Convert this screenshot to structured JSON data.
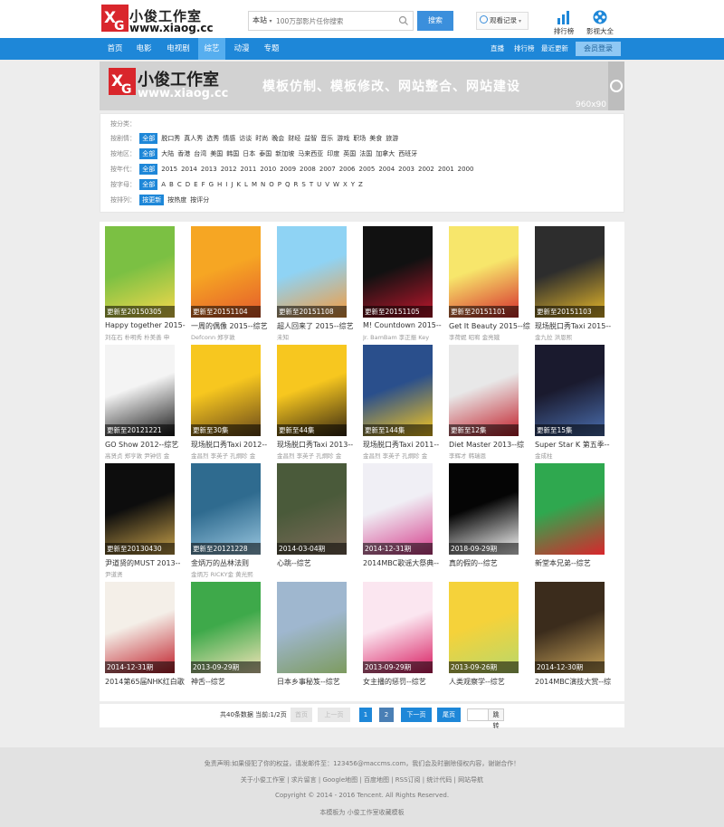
{
  "header": {
    "logo_cn": "小俊工作室",
    "logo_en": "www.xiaog.cc",
    "search_category": "本站",
    "search_placeholder": "100万部影片任你搜索",
    "search_button": "搜索",
    "history_label": "观看记录",
    "rank_label": "排行榜",
    "movies_label": "影视大全"
  },
  "nav": {
    "items": [
      "首页",
      "电影",
      "电视剧",
      "综艺",
      "动漫",
      "专题"
    ],
    "active_index": 3,
    "right_links": [
      "直播",
      "排行榜",
      "最近更新"
    ],
    "member_button": "会员登录"
  },
  "banner": {
    "logo_cn": "小俊工作室",
    "logo_en": "www.xiaog.cc",
    "slogan": "模板仿制、模板修改、网站整合、网站建设",
    "size_text": "960x90"
  },
  "filters": {
    "category_label": "按分类：",
    "genre": {
      "label": "按剧情：",
      "options": [
        "全部",
        "脱口秀",
        "真人秀",
        "选秀",
        "情感",
        "访谈",
        "时尚",
        "晚会",
        "财经",
        "益智",
        "音乐",
        "游戏",
        "职场",
        "美食",
        "旅游"
      ]
    },
    "region": {
      "label": "按地区：",
      "options": [
        "全部",
        "大陆",
        "香港",
        "台湾",
        "美国",
        "韩国",
        "日本",
        "泰国",
        "新加坡",
        "马来西亚",
        "印度",
        "英国",
        "法国",
        "加拿大",
        "西班牙"
      ]
    },
    "year": {
      "label": "按年代：",
      "options": [
        "全部",
        "2015",
        "2014",
        "2013",
        "2012",
        "2011",
        "2010",
        "2009",
        "2008",
        "2007",
        "2006",
        "2005",
        "2004",
        "2003",
        "2002",
        "2001",
        "2000"
      ]
    },
    "letter": {
      "label": "按字母：",
      "options": [
        "全部",
        "A",
        "B",
        "C",
        "D",
        "E",
        "F",
        "G",
        "H",
        "I",
        "J",
        "K",
        "L",
        "M",
        "N",
        "O",
        "P",
        "Q",
        "R",
        "S",
        "T",
        "U",
        "V",
        "W",
        "X",
        "Y",
        "Z"
      ]
    },
    "sort": {
      "label": "按排列：",
      "options": [
        "按更新",
        "按热度",
        "按评分"
      ]
    }
  },
  "cards": [
    {
      "title": "Happy together 2015-",
      "sub": "刘在石 朴明秀 朴美善 申",
      "badge": "更新至20150305",
      "colors": [
        "#7bc043",
        "#f7d94c"
      ]
    },
    {
      "title": "一周的偶像 2015--综艺",
      "sub": "Defconn 郑亨敦",
      "badge": "更新至20151104",
      "colors": [
        "#f6a623",
        "#e45a2c"
      ]
    },
    {
      "title": "超人回来了 2015--综艺",
      "sub": "未知",
      "badge": "更新至20151108",
      "colors": [
        "#8fd3f4",
        "#f59b3d"
      ]
    },
    {
      "title": "M! Countdown 2015--",
      "sub": "Jr. BamBam 李正振 Key",
      "badge": "更新至20151105",
      "colors": [
        "#111111",
        "#c0172d"
      ]
    },
    {
      "title": "Get It Beauty 2015--综",
      "sub": "李荷妮 昭宥 金亮娥",
      "badge": "更新至20151101",
      "colors": [
        "#f7e66b",
        "#d62c2c"
      ]
    },
    {
      "title": "现场脱口秀Taxi 2015--",
      "sub": "金九拉 洪恩熙",
      "badge": "更新至20151103",
      "colors": [
        "#2d2d2d",
        "#e8b92a"
      ]
    },
    {
      "title": "GO Show 2012--综艺",
      "sub": "高贤贞 郑亨敦 尹钟信 金",
      "badge": "更新至20121221",
      "colors": [
        "#f4f4f4",
        "#1a1a1a"
      ]
    },
    {
      "title": "现场脱口秀Taxi 2012--",
      "sub": "金昌烈 李英子 孔炯眕 金",
      "badge": "更新至30集",
      "colors": [
        "#f7c71f",
        "#6b4a1a"
      ]
    },
    {
      "title": "现场脱口秀Taxi 2013--",
      "sub": "金昌烈 李英子 孔炯眕 金",
      "badge": "更新至44集",
      "colors": [
        "#f7c71f",
        "#3a2a12"
      ]
    },
    {
      "title": "现场脱口秀Taxi 2011--",
      "sub": "金昌烈 李英子 孔炯眕 金",
      "badge": "更新至144集",
      "colors": [
        "#2a4f8c",
        "#f7c71f"
      ]
    },
    {
      "title": "Diet Master 2013--综",
      "sub": "李辉才 韩瑞恩",
      "badge": "更新至12集",
      "colors": [
        "#e8e8e8",
        "#c21f2a"
      ]
    },
    {
      "title": "Super Star K 第五季--",
      "sub": "金成柱",
      "badge": "更新至15集",
      "colors": [
        "#1a1a2e",
        "#4b6fb0"
      ]
    },
    {
      "title": "尹道贤的MUST 2013--",
      "sub": "尹道贤",
      "badge": "更新至20130430",
      "colors": [
        "#0d0d0d",
        "#c9a24a"
      ]
    },
    {
      "title": "金炳万的丛林法则",
      "sub": "金炳万 RICKY金 黄光熙",
      "badge": "更新至20121228",
      "colors": [
        "#2f6b8f",
        "#9ac7e0"
      ]
    },
    {
      "title": "心跳--综艺",
      "sub": "",
      "badge": "2014-03-04期",
      "colors": [
        "#4a5a3a",
        "#7d6b5a"
      ]
    },
    {
      "title": "2014MBC歌谣大祭典--",
      "sub": "",
      "badge": "2014-12-31期",
      "colors": [
        "#f0eff5",
        "#d53f8c"
      ]
    },
    {
      "title": "真的假的--综艺",
      "sub": "",
      "badge": "2018-09-29期",
      "colors": [
        "#050505",
        "#ffffff"
      ]
    },
    {
      "title": "新堂本兄弟--综艺",
      "sub": "",
      "badge": "",
      "colors": [
        "#2fa84f",
        "#d9262c"
      ]
    },
    {
      "title": "2014第65届NHK红白歌",
      "sub": "",
      "badge": "2014-12-31期",
      "colors": [
        "#f4efe8",
        "#c01f2a"
      ]
    },
    {
      "title": "神舌--综艺",
      "sub": "",
      "badge": "2013-09-29期",
      "colors": [
        "#3ea94a",
        "#f3e4b8"
      ]
    },
    {
      "title": "日本乡事秘笈--综艺",
      "sub": "",
      "badge": "",
      "colors": [
        "#9fb7cf",
        "#7d9b5f"
      ]
    },
    {
      "title": "女主播的惩罚--综艺",
      "sub": "",
      "badge": "2013-09-29期",
      "colors": [
        "#fbe6f0",
        "#d81b60"
      ]
    },
    {
      "title": "人类观察学--综艺",
      "sub": "",
      "badge": "2013-09-26期",
      "colors": [
        "#f5d23a",
        "#b8d86b"
      ]
    },
    {
      "title": "2014MBC演技大赏--综",
      "sub": "",
      "badge": "2014-12-30期",
      "colors": [
        "#3b2c1c",
        "#c9a45a"
      ]
    }
  ],
  "pager": {
    "info": "共40条数据 当前:1/2页",
    "first": "首页",
    "prev": "上一页",
    "page1": "1",
    "page2": "2",
    "next": "下一页",
    "last": "尾页",
    "go": "跳 转"
  },
  "footer": {
    "disclaimer": "免责声明:如果侵犯了你的权益，请发邮件至：123456@maccms.com，我们会及时删除侵权内容，谢谢合作！",
    "links": "关于小俊工作室 | 求片留言 | Google地图 | 百度地图 | RSS订阅 | 统计代码 | 网站导航",
    "copyright": "Copyright © 2014 - 2016 Tencent. All Rights Reserved.",
    "credit": "本模板为 小俊工作室收藏模板"
  }
}
